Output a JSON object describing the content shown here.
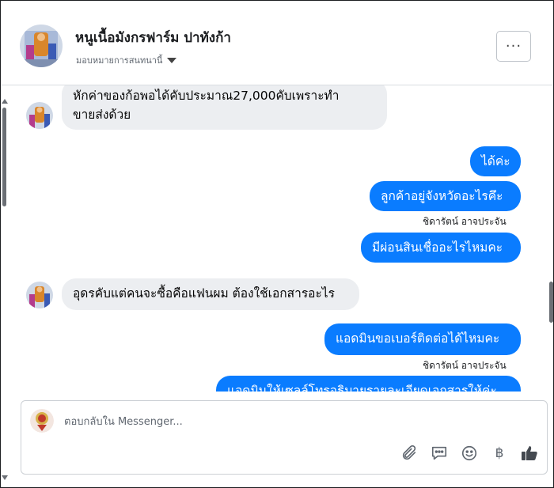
{
  "header": {
    "page_name": "หนูเนื้อมังกรฟาร์ม ปาทังก้า",
    "assign_label": "มอบหมายการสนทนานี้",
    "more_label": "···"
  },
  "messages": [
    {
      "side": "in",
      "lines": [
        "หักค่าของก้อพอได้คับประมาณ27,000คับเพราะทำ",
        "ขายส่งด้วย"
      ]
    },
    {
      "side": "out",
      "text": "ได้ค่ะ"
    },
    {
      "side": "out",
      "text": "ลูกค้าอยู่จังหวัดอะไรคึะ",
      "sender": "ชิดารัตน์ อาจประจัน"
    },
    {
      "side": "out",
      "text": "มีผ่อนสินเชื่ออะไรไหมคะ"
    },
    {
      "side": "in",
      "text": "อุดรคับแต่คนจะซื้อคือแฟนผม ต้องใช้เอกสารอะไร"
    },
    {
      "side": "out",
      "text": "แอดมินขอเบอร์ติดต่อได้ไหมคะ",
      "sender": "ชิดารัตน์ อาจประจัน"
    },
    {
      "side": "out",
      "text": "แอดมินให้เซลล์โทรอธิบายรายละเอียดเอกสารให้ค่ะ"
    }
  ],
  "composer": {
    "placeholder": "ตอบกลับใน Messenger..."
  },
  "tools": {
    "attach": "paperclip-icon",
    "saved_replies": "chat-bubble-icon",
    "emoji": "smiley-icon",
    "payment": "฿",
    "like": "thumbs-up-icon"
  }
}
